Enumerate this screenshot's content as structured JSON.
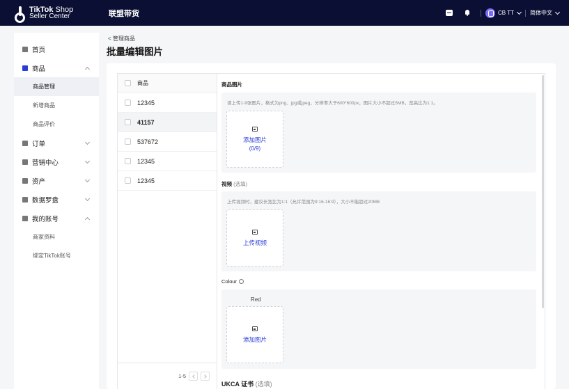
{
  "topbar": {
    "logo_line1_bold": "TikTok",
    "logo_line1_light": " Shop",
    "logo_line2": "Seller Center",
    "title": "联盟带货",
    "user_name": "CB TT",
    "language": "简体中文"
  },
  "sidebar": {
    "items": [
      {
        "label": "首页",
        "icon": "home-icon"
      },
      {
        "label": "商品",
        "icon": "product-icon",
        "expanded": true,
        "children": [
          "商品管理",
          "新增商品",
          "商品评价"
        ]
      },
      {
        "label": "订单",
        "icon": "order-icon"
      },
      {
        "label": "营销中心",
        "icon": "marketing-icon"
      },
      {
        "label": "资产",
        "icon": "asset-icon"
      },
      {
        "label": "数据罗盘",
        "icon": "data-compass-icon"
      },
      {
        "label": "我的账号",
        "icon": "account-icon",
        "expanded": true,
        "children": [
          "商家资料",
          "绑定TikTok账号"
        ]
      }
    ],
    "active_sub": "商品管理"
  },
  "breadcrumb": "< 管理商品",
  "page_title": "批量编辑图片",
  "product_list": {
    "header": "商品",
    "rows": [
      "12345",
      "41157",
      "537672",
      "12345",
      "12345"
    ],
    "selected_index": 1,
    "pagination": "1-5"
  },
  "editor": {
    "images": {
      "title": "商品图片",
      "hint": "请上传1-9张图片，格式为png、jpg或jpeg，分辨率大于600*600px，图片大小不超过5MB，宽高比为1:1。",
      "upload_label": "添加图片",
      "upload_count": "(0/9)"
    },
    "video": {
      "title": "视频",
      "optional": " (选填)",
      "hint": "上传视频时，建议长宽比为1:1（允许范围为9:16-16:9），大小不能超过20MB",
      "upload_label": "上传视频"
    },
    "colour": {
      "title": "Colour",
      "variant": "Red",
      "upload_label": "添加图片"
    },
    "ukca": {
      "title": "UKCA 证书",
      "optional": " (选填)"
    }
  },
  "colors": {
    "topbar": "#0b0f33",
    "accent": "#2b3cd8",
    "avatar": "#7b6cf6"
  }
}
